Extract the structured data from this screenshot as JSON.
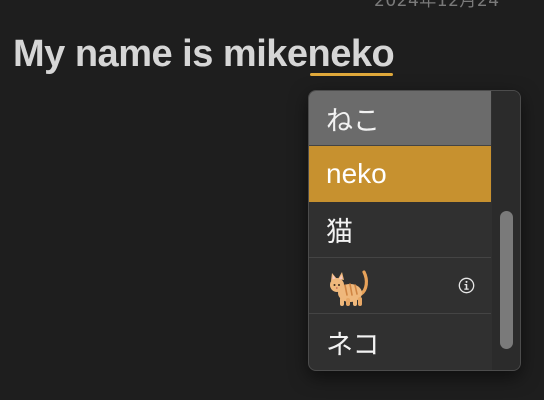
{
  "header": {
    "date_partial": "2024年12月24"
  },
  "editor": {
    "committed_text": "My name is mike",
    "composing_text": "neko",
    "accent_color": "#e0a93b"
  },
  "ime_candidates": {
    "items": [
      {
        "text": "ねこ",
        "state": "highlighted"
      },
      {
        "text": "neko",
        "state": "selected"
      },
      {
        "text": "猫",
        "state": "normal"
      },
      {
        "icon": "cat-emoji-icon",
        "info_icon": "info-circle-icon",
        "state": "normal"
      },
      {
        "text": "ネコ",
        "state": "normal"
      }
    ],
    "selected_color": "#c7912f",
    "highlight_color": "#6b6b6b"
  }
}
